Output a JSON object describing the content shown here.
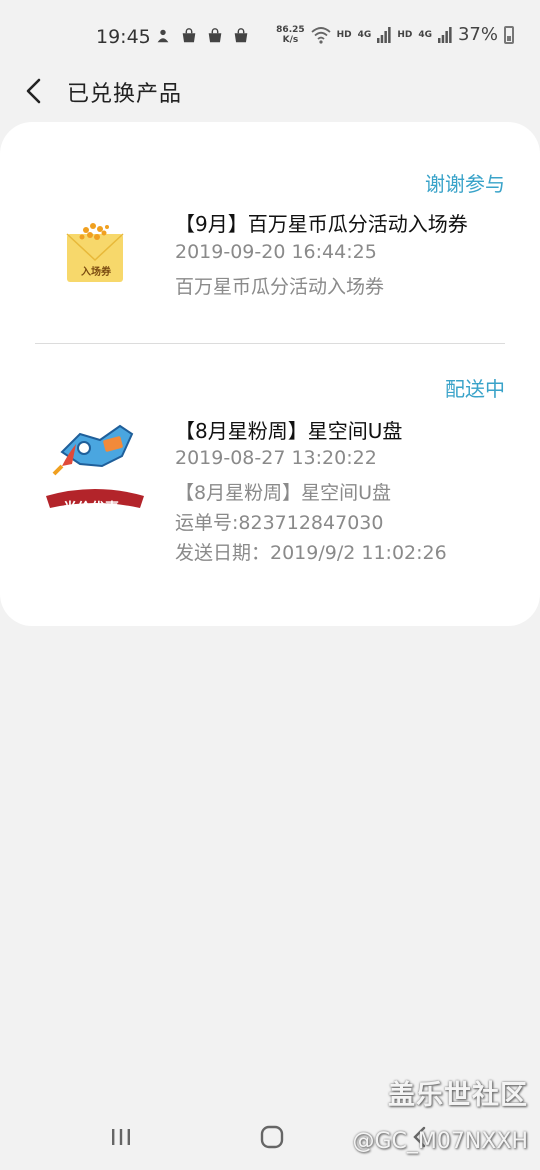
{
  "status_bar": {
    "time": "19:45",
    "net_speed_value": "86.25",
    "net_speed_unit": "K/s",
    "hd1": "HD",
    "lte1": "4G",
    "hd2": "HD",
    "lte2": "4G",
    "battery": "37%"
  },
  "header": {
    "title": "已兑换产品"
  },
  "items": [
    {
      "status": "谢谢参与",
      "name": "【9月】百万星币瓜分活动入场券",
      "lines": [
        "2019-09-20 16:44:25",
        "百万星币瓜分活动入场券"
      ],
      "thumb_text": "入场券"
    },
    {
      "status": "配送中",
      "name": "【8月星粉周】星空间U盘",
      "lines": [
        "2019-08-27 13:20:22",
        "【8月星粉周】星空间U盘",
        "运单号:823712847030",
        "发送日期：2019/9/2 11:02:26"
      ],
      "thumb_text": "半价优惠"
    }
  ],
  "watermark": {
    "site": "盖乐世社区",
    "user": "@GC_M07NXXH"
  },
  "colors": {
    "status_accent": "#3aa3c9",
    "badge_red": "#b3242a",
    "coupon_yellow": "#f7d86b"
  }
}
